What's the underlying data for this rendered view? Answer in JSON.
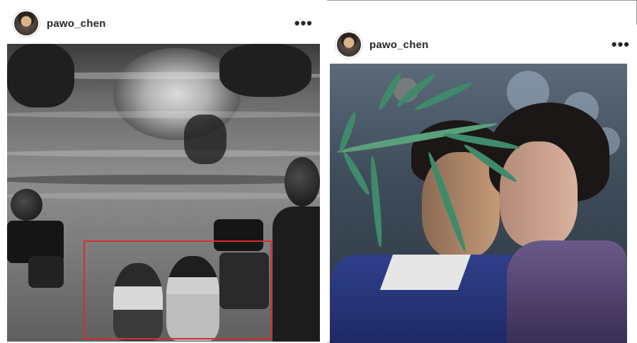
{
  "posts": [
    {
      "username": "pawo_chen",
      "more_label": "•••"
    },
    {
      "username": "pawo_chen",
      "more_label": "•••"
    }
  ],
  "colors": {
    "highlight_box": "#d32f2f",
    "username_text": "#262626",
    "frame_border": "#9a9a9a"
  },
  "icons": {
    "more": "more-options-icon"
  }
}
